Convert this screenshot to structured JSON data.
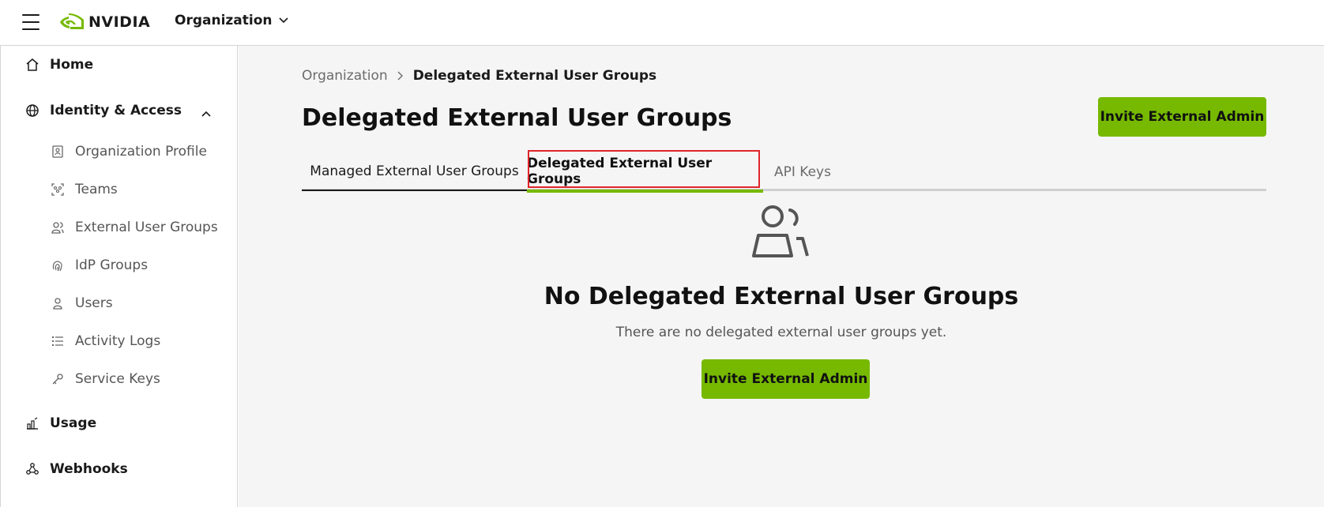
{
  "colors": {
    "accent": "#76b900",
    "highlight": "#e0242b",
    "background": "#f5f5f5"
  },
  "header": {
    "brand": "NVIDIA",
    "org_switcher": "Organization"
  },
  "sidebar": {
    "home": "Home",
    "identity": "Identity & Access",
    "items": [
      {
        "label": "Organization Profile",
        "icon": "id-card-icon"
      },
      {
        "label": "Teams",
        "icon": "team-icon"
      },
      {
        "label": "External User Groups",
        "icon": "users-icon"
      },
      {
        "label": "IdP Groups",
        "icon": "fingerprint-icon"
      },
      {
        "label": "Users",
        "icon": "user-icon"
      },
      {
        "label": "Activity Logs",
        "icon": "list-icon"
      },
      {
        "label": "Service Keys",
        "icon": "key-icon"
      }
    ],
    "usage": "Usage",
    "webhooks": "Webhooks"
  },
  "main": {
    "breadcrumb": {
      "parent": "Organization",
      "current": "Delegated External User Groups"
    },
    "title": "Delegated External User Groups",
    "invite_button": "Invite External Admin",
    "tabs": [
      {
        "label": "Managed External User Groups"
      },
      {
        "label": "Delegated External User Groups"
      },
      {
        "label": "API Keys"
      }
    ],
    "empty": {
      "title": "No Delegated External User Groups",
      "description": "There are no delegated external user groups yet.",
      "button": "Invite External Admin"
    }
  }
}
